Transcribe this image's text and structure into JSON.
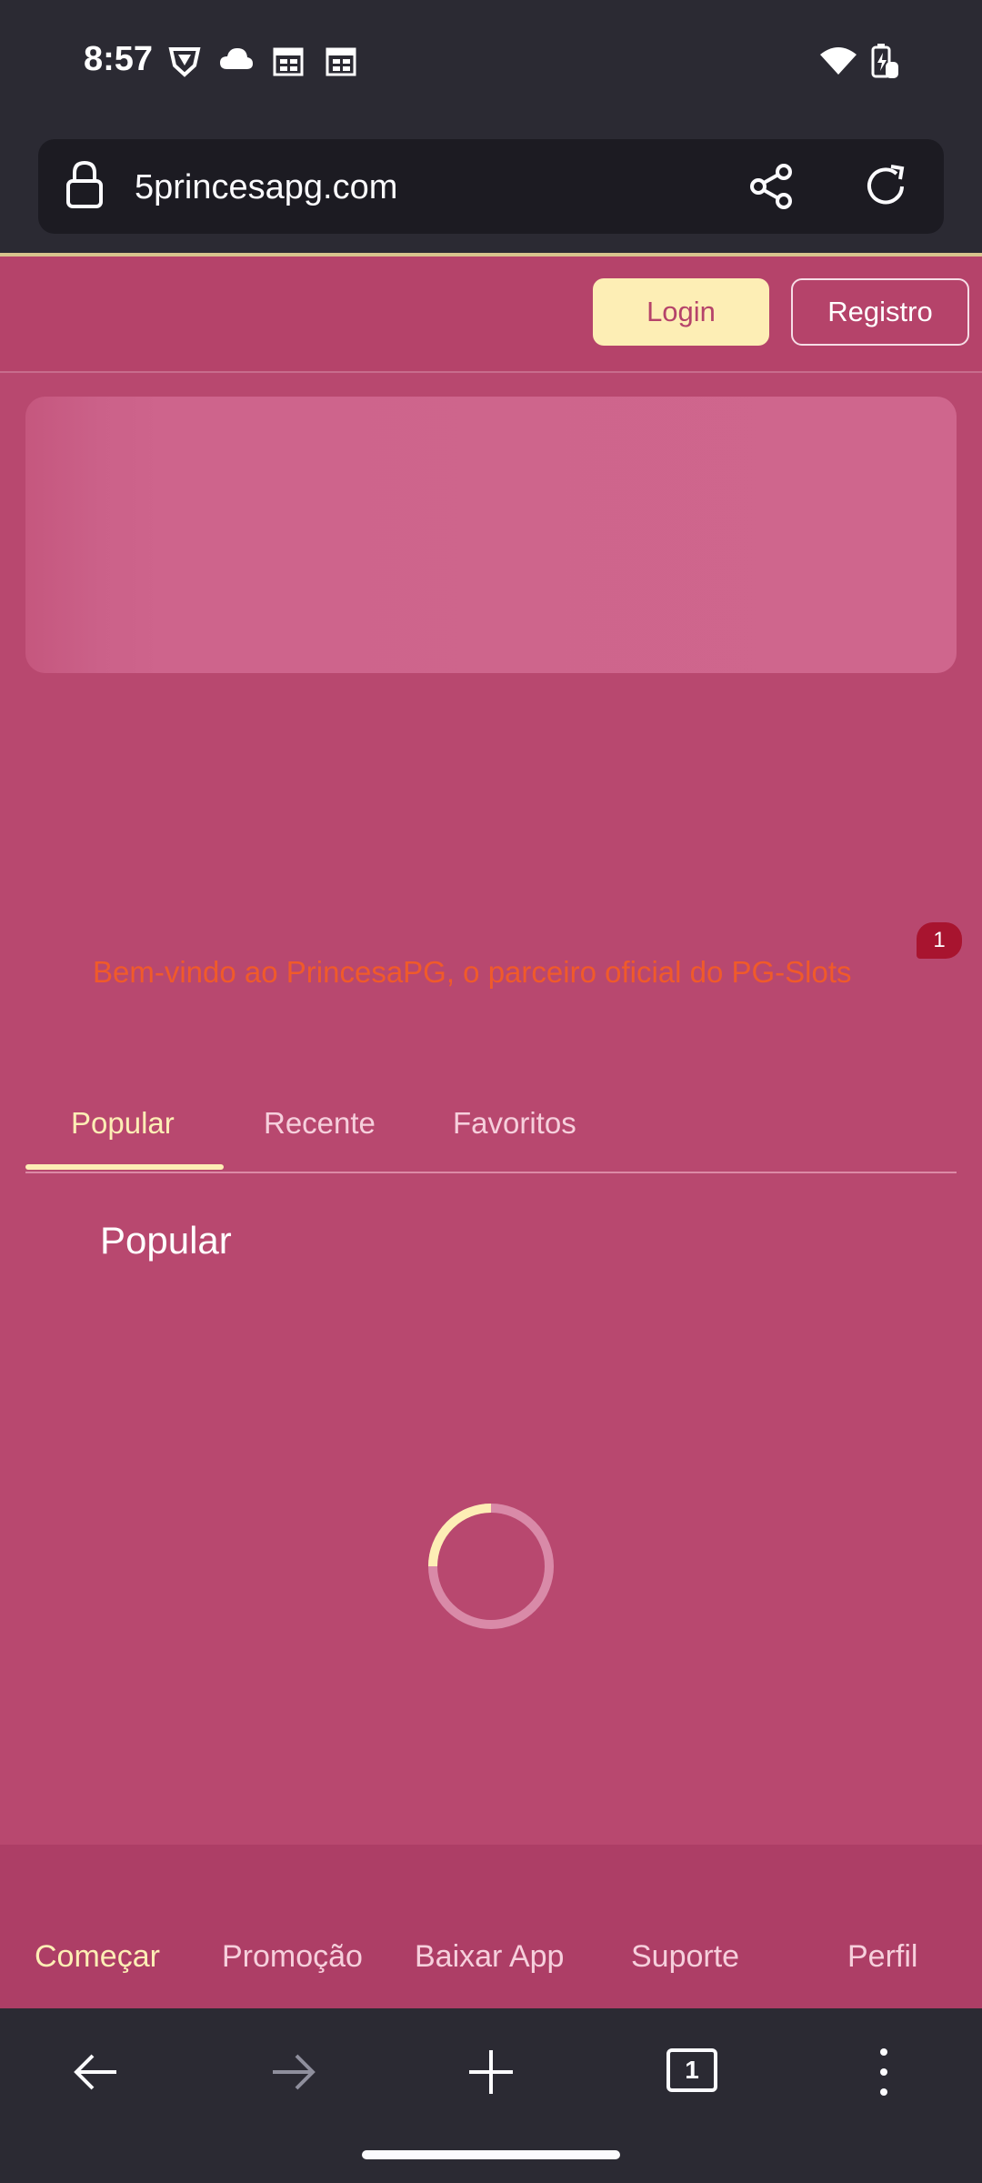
{
  "status_bar": {
    "time": "8:57"
  },
  "browser": {
    "url": "5princesapg.com",
    "tab_count": "1"
  },
  "header": {
    "login_label": "Login",
    "register_label": "Registro"
  },
  "marquee": {
    "text": "Bem-vindo ao PrincesaPG, o parceiro oficial do PG-Slots",
    "badge_count": "1"
  },
  "tabs": [
    {
      "label": "Popular"
    },
    {
      "label": "Recente"
    },
    {
      "label": "Favoritos"
    }
  ],
  "section": {
    "title": "Popular"
  },
  "bottom_nav": [
    {
      "label": "Começar"
    },
    {
      "label": "Promoção"
    },
    {
      "label": "Baixar App"
    },
    {
      "label": "Suporte"
    },
    {
      "label": "Perfil"
    }
  ],
  "colors": {
    "page_bg": "#b8486f",
    "accent_yellow": "#fdeeb5",
    "marquee_orange": "#f05a2a",
    "browser_chrome": "#2b2a33"
  }
}
